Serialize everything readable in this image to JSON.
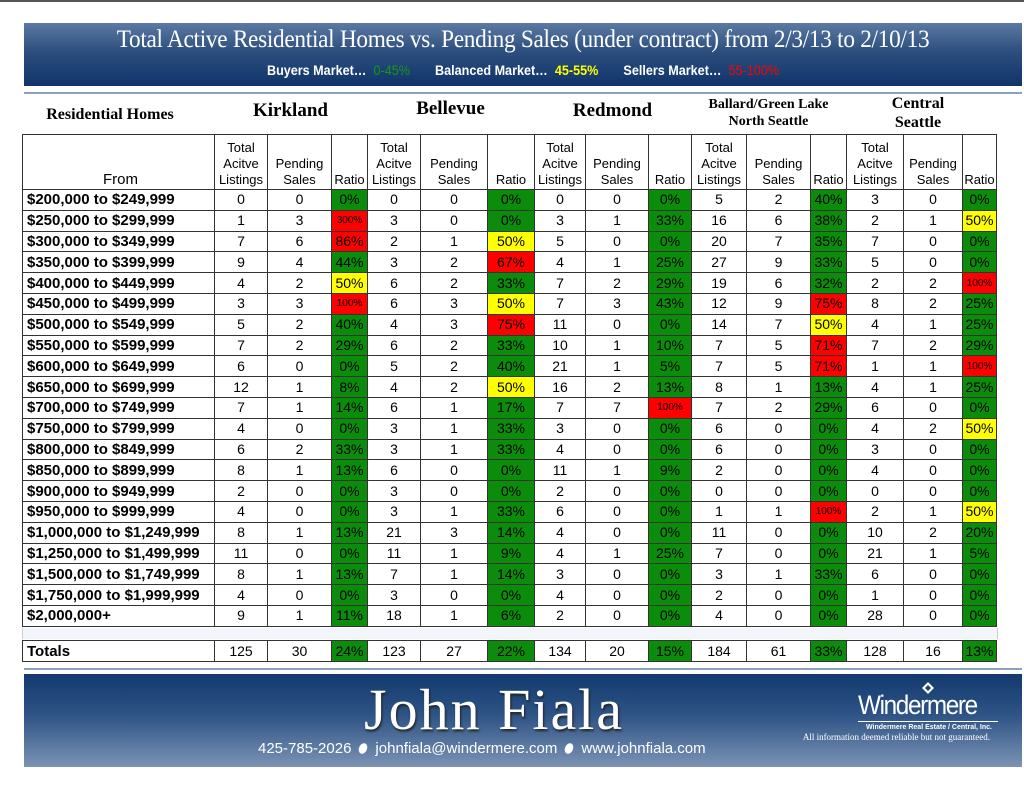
{
  "header": {
    "title": "Total Active Residential Homes vs. Pending Sales (under contract) from 2/3/13 to 2/10/13",
    "legend": [
      {
        "label": "Buyers Market…",
        "range": "0-45%",
        "color": "#129a12"
      },
      {
        "label": "Balanced Market…",
        "range": "45-55%",
        "color": "#ffff00"
      },
      {
        "label": "Sellers Market…",
        "range": "55-100%",
        "color": "#ff0000"
      }
    ]
  },
  "table": {
    "section_label": "Residential Homes",
    "regions": [
      {
        "name": "Kirkland"
      },
      {
        "name": "Bellevue"
      },
      {
        "name": "Redmond"
      },
      {
        "name": "Ballard/Green Lake North Seattle"
      },
      {
        "name": "Central Seattle"
      }
    ],
    "row_header": "From",
    "column_headers": [
      "Total Acitve Listings",
      "Pending Sales",
      "Ratio"
    ],
    "status_colors": {
      "green": "#0b8c0b",
      "yellow": "#ffff00",
      "red": "#ff0000"
    },
    "rows": [
      {
        "range": "$200,000 to $249,999",
        "cells": [
          [
            "0",
            "0",
            "0%",
            "green"
          ],
          [
            "0",
            "0",
            "0%",
            "green"
          ],
          [
            "0",
            "0",
            "0%",
            "green"
          ],
          [
            "5",
            "2",
            "40%",
            "green"
          ],
          [
            "3",
            "0",
            "0%",
            "green"
          ]
        ]
      },
      {
        "range": "$250,000 to $299,999",
        "cells": [
          [
            "1",
            "3",
            "300%",
            "red"
          ],
          [
            "3",
            "0",
            "0%",
            "green"
          ],
          [
            "3",
            "1",
            "33%",
            "green"
          ],
          [
            "16",
            "6",
            "38%",
            "green"
          ],
          [
            "2",
            "1",
            "50%",
            "yellow"
          ]
        ]
      },
      {
        "range": "$300,000 to $349,999",
        "cells": [
          [
            "7",
            "6",
            "86%",
            "red"
          ],
          [
            "2",
            "1",
            "50%",
            "yellow"
          ],
          [
            "5",
            "0",
            "0%",
            "green"
          ],
          [
            "20",
            "7",
            "35%",
            "green"
          ],
          [
            "7",
            "0",
            "0%",
            "green"
          ]
        ]
      },
      {
        "range": "$350,000 to $399,999",
        "cells": [
          [
            "9",
            "4",
            "44%",
            "green"
          ],
          [
            "3",
            "2",
            "67%",
            "red"
          ],
          [
            "4",
            "1",
            "25%",
            "green"
          ],
          [
            "27",
            "9",
            "33%",
            "green"
          ],
          [
            "5",
            "0",
            "0%",
            "green"
          ]
        ]
      },
      {
        "range": "$400,000 to $449,999",
        "cells": [
          [
            "4",
            "2",
            "50%",
            "yellow"
          ],
          [
            "6",
            "2",
            "33%",
            "green"
          ],
          [
            "7",
            "2",
            "29%",
            "green"
          ],
          [
            "19",
            "6",
            "32%",
            "green"
          ],
          [
            "2",
            "2",
            "100%",
            "red"
          ]
        ]
      },
      {
        "range": "$450,000 to $499,999",
        "cells": [
          [
            "3",
            "3",
            "100%",
            "red"
          ],
          [
            "6",
            "3",
            "50%",
            "yellow"
          ],
          [
            "7",
            "3",
            "43%",
            "green"
          ],
          [
            "12",
            "9",
            "75%",
            "red"
          ],
          [
            "8",
            "2",
            "25%",
            "green"
          ]
        ]
      },
      {
        "range": "$500,000 to $549,999",
        "cells": [
          [
            "5",
            "2",
            "40%",
            "green"
          ],
          [
            "4",
            "3",
            "75%",
            "red"
          ],
          [
            "11",
            "0",
            "0%",
            "green"
          ],
          [
            "14",
            "7",
            "50%",
            "yellow"
          ],
          [
            "4",
            "1",
            "25%",
            "green"
          ]
        ]
      },
      {
        "range": "$550,000 to $599,999",
        "cells": [
          [
            "7",
            "2",
            "29%",
            "green"
          ],
          [
            "6",
            "2",
            "33%",
            "green"
          ],
          [
            "10",
            "1",
            "10%",
            "green"
          ],
          [
            "7",
            "5",
            "71%",
            "red"
          ],
          [
            "7",
            "2",
            "29%",
            "green"
          ]
        ]
      },
      {
        "range": "$600,000 to $649,999",
        "cells": [
          [
            "6",
            "0",
            "0%",
            "green"
          ],
          [
            "5",
            "2",
            "40%",
            "green"
          ],
          [
            "21",
            "1",
            "5%",
            "green"
          ],
          [
            "7",
            "5",
            "71%",
            "red"
          ],
          [
            "1",
            "1",
            "100%",
            "red"
          ]
        ]
      },
      {
        "range": "$650,000 to $699,999",
        "cells": [
          [
            "12",
            "1",
            "8%",
            "green"
          ],
          [
            "4",
            "2",
            "50%",
            "yellow"
          ],
          [
            "16",
            "2",
            "13%",
            "green"
          ],
          [
            "8",
            "1",
            "13%",
            "green"
          ],
          [
            "4",
            "1",
            "25%",
            "green"
          ]
        ]
      },
      {
        "range": "$700,000 to $749,999",
        "cells": [
          [
            "7",
            "1",
            "14%",
            "green"
          ],
          [
            "6",
            "1",
            "17%",
            "green"
          ],
          [
            "7",
            "7",
            "100%",
            "red"
          ],
          [
            "7",
            "2",
            "29%",
            "green"
          ],
          [
            "6",
            "0",
            "0%",
            "green"
          ]
        ]
      },
      {
        "range": "$750,000 to $799,999",
        "cells": [
          [
            "4",
            "0",
            "0%",
            "green"
          ],
          [
            "3",
            "1",
            "33%",
            "green"
          ],
          [
            "3",
            "0",
            "0%",
            "green"
          ],
          [
            "6",
            "0",
            "0%",
            "green"
          ],
          [
            "4",
            "2",
            "50%",
            "yellow"
          ]
        ]
      },
      {
        "range": "$800,000 to $849,999",
        "cells": [
          [
            "6",
            "2",
            "33%",
            "green"
          ],
          [
            "3",
            "1",
            "33%",
            "green"
          ],
          [
            "4",
            "0",
            "0%",
            "green"
          ],
          [
            "6",
            "0",
            "0%",
            "green"
          ],
          [
            "3",
            "0",
            "0%",
            "green"
          ]
        ]
      },
      {
        "range": "$850,000 to $899,999",
        "cells": [
          [
            "8",
            "1",
            "13%",
            "green"
          ],
          [
            "6",
            "0",
            "0%",
            "green"
          ],
          [
            "11",
            "1",
            "9%",
            "green"
          ],
          [
            "2",
            "0",
            "0%",
            "green"
          ],
          [
            "4",
            "0",
            "0%",
            "green"
          ]
        ]
      },
      {
        "range": "$900,000 to $949,999",
        "cells": [
          [
            "2",
            "0",
            "0%",
            "green"
          ],
          [
            "3",
            "0",
            "0%",
            "green"
          ],
          [
            "2",
            "0",
            "0%",
            "green"
          ],
          [
            "0",
            "0",
            "0%",
            "green"
          ],
          [
            "0",
            "0",
            "0%",
            "green"
          ]
        ]
      },
      {
        "range": "$950,000 to $999,999",
        "cells": [
          [
            "4",
            "0",
            "0%",
            "green"
          ],
          [
            "3",
            "1",
            "33%",
            "green"
          ],
          [
            "6",
            "0",
            "0%",
            "green"
          ],
          [
            "1",
            "1",
            "100%",
            "red"
          ],
          [
            "2",
            "1",
            "50%",
            "yellow"
          ]
        ]
      },
      {
        "range": "$1,000,000 to $1,249,999",
        "cells": [
          [
            "8",
            "1",
            "13%",
            "green"
          ],
          [
            "21",
            "3",
            "14%",
            "green"
          ],
          [
            "4",
            "0",
            "0%",
            "green"
          ],
          [
            "11",
            "0",
            "0%",
            "green"
          ],
          [
            "10",
            "2",
            "20%",
            "green"
          ]
        ]
      },
      {
        "range": "$1,250,000 to $1,499,999",
        "cells": [
          [
            "11",
            "0",
            "0%",
            "green"
          ],
          [
            "11",
            "1",
            "9%",
            "green"
          ],
          [
            "4",
            "1",
            "25%",
            "green"
          ],
          [
            "7",
            "0",
            "0%",
            "green"
          ],
          [
            "21",
            "1",
            "5%",
            "green"
          ]
        ]
      },
      {
        "range": "$1,500,000 to $1,749,999",
        "cells": [
          [
            "8",
            "1",
            "13%",
            "green"
          ],
          [
            "7",
            "1",
            "14%",
            "green"
          ],
          [
            "3",
            "0",
            "0%",
            "green"
          ],
          [
            "3",
            "1",
            "33%",
            "green"
          ],
          [
            "6",
            "0",
            "0%",
            "green"
          ]
        ]
      },
      {
        "range": "$1,750,000 to $1,999,999",
        "cells": [
          [
            "4",
            "0",
            "0%",
            "green"
          ],
          [
            "3",
            "0",
            "0%",
            "green"
          ],
          [
            "4",
            "0",
            "0%",
            "green"
          ],
          [
            "2",
            "0",
            "0%",
            "green"
          ],
          [
            "1",
            "0",
            "0%",
            "green"
          ]
        ]
      },
      {
        "range": "$2,000,000+",
        "cells": [
          [
            "9",
            "1",
            "11%",
            "green"
          ],
          [
            "18",
            "1",
            "6%",
            "green"
          ],
          [
            "2",
            "0",
            "0%",
            "green"
          ],
          [
            "4",
            "0",
            "0%",
            "green"
          ],
          [
            "28",
            "0",
            "0%",
            "green"
          ]
        ]
      }
    ],
    "totals": {
      "label": "Totals",
      "cells": [
        [
          "125",
          "30",
          "24%",
          "green"
        ],
        [
          "123",
          "27",
          "22%",
          "green"
        ],
        [
          "134",
          "20",
          "15%",
          "green"
        ],
        [
          "184",
          "61",
          "33%",
          "green"
        ],
        [
          "128",
          "16",
          "13%",
          "green"
        ]
      ]
    }
  },
  "footer": {
    "agent_name": "John Fiala",
    "phone": "425-785-2026",
    "email": "johnfiala@windermere.com",
    "website": "www.johnfiala.com",
    "brand": "Windermere",
    "brand_sub": "Windermere Real Estate / Central, Inc.",
    "disclaimer": "All information deemed reliable but not guaranteed."
  }
}
